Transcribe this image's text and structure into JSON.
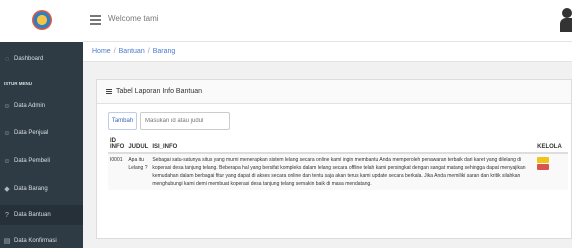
{
  "header": {
    "welcome": "Welcome tami"
  },
  "sidebar": {
    "items": [
      {
        "label": "Dashboard",
        "icon": "dashboard-icon"
      },
      {
        "label": "Data Admin",
        "icon": "user-icon"
      },
      {
        "label": "Data Penjual",
        "icon": "user-icon"
      },
      {
        "label": "Data Pembeli",
        "icon": "user-icon"
      },
      {
        "label": "Data Barang",
        "icon": "tag-icon"
      },
      {
        "label": "Data Bantuan",
        "icon": "help-icon"
      },
      {
        "label": "Data Konfirmasi",
        "icon": "document-icon"
      }
    ],
    "section_label": "ISTUR MENU"
  },
  "breadcrumb": {
    "home": "Home",
    "bantuan": "Bantuan",
    "barang": "Barang"
  },
  "panel": {
    "title": "Tabel Laporan Info Bantuan",
    "add_button": "Tambah",
    "search_placeholder": "Masukan id atau judul"
  },
  "table": {
    "headers": {
      "id": "ID INFO",
      "judul": "JUDUL",
      "isi": "ISI_INFO",
      "kelola": "KELOLA"
    },
    "rows": [
      {
        "id": "I0001",
        "judul": "Apa itu Lelang ?",
        "isi": "Sebagai satu-satunya situs yang murni menerapkan sistem lelang secara online kami ingin membantu Anda memperoleh penawaran terbaik dari karet yang dilelang di koperasi desa tanjung telang. Beberapa hal yang bersifat kompleks dalam lelang secara offline telah kami persingkat dengan sangat matang sehingga dapat menyajikan kemudahan dalam berbagai fitur yang dapat di akses secara online dan tentu saja akan terus kami update secara berkala. Jika Anda memiliki saran dan kritik silahkan menghubungi kami demi membuat koperasi desa tanjung telang semakin baik di masa mendatang."
      }
    ]
  },
  "colors": {
    "sidebar_bg": "#2f3b44",
    "link": "#4a7bd0",
    "edit": "#f0c51a",
    "delete": "#d9534f"
  }
}
